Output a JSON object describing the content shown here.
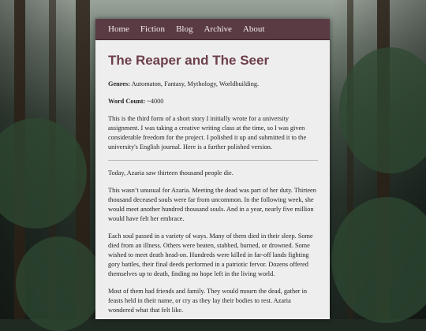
{
  "nav": {
    "items": [
      "Home",
      "Fiction",
      "Blog",
      "Archive",
      "About"
    ]
  },
  "article": {
    "title": "The Reaper and The Seer",
    "genres_label": "Genres:",
    "genres_value": "Automaton, Fantasy, Mythology, Worldbuilding.",
    "wordcount_label": "Word Count:",
    "wordcount_value": "~4000",
    "intro": "This is the third form of a short story I initially wrote for a university assignment. I was taking a creative writing class at the time, so I was given considerable freedom for the project. I polished it up and submitted it to the university's English journal. Here is a further polished version.",
    "paragraphs": [
      "Today, Azaria saw thirteen thousand people die.",
      "This wasn’t unusual for Azaria. Meeting the dead was part of her duty. Thirteen thousand deceased souls were far from uncommon. In the following week, she would meet another hundred thousand souls. And in a year, nearly five million would have felt her embrace.",
      "Each soul passed in a variety of ways. Many of them died in their sleep. Some died from an illness. Others were beaten, stabbed, burned, or drowned. Some wished to meet death head-on. Hundreds were killed in far-off lands fighting gory battles, their final deeds performed in a patriotic fervor. Dozens offered themselves up to death, finding no hope left in the living world.",
      "Most of them had friends and family. They would mourn the dead, gather in feasts held in their name, or cry as they lay their bodies to rest. Azaria wondered what that felt like."
    ]
  }
}
